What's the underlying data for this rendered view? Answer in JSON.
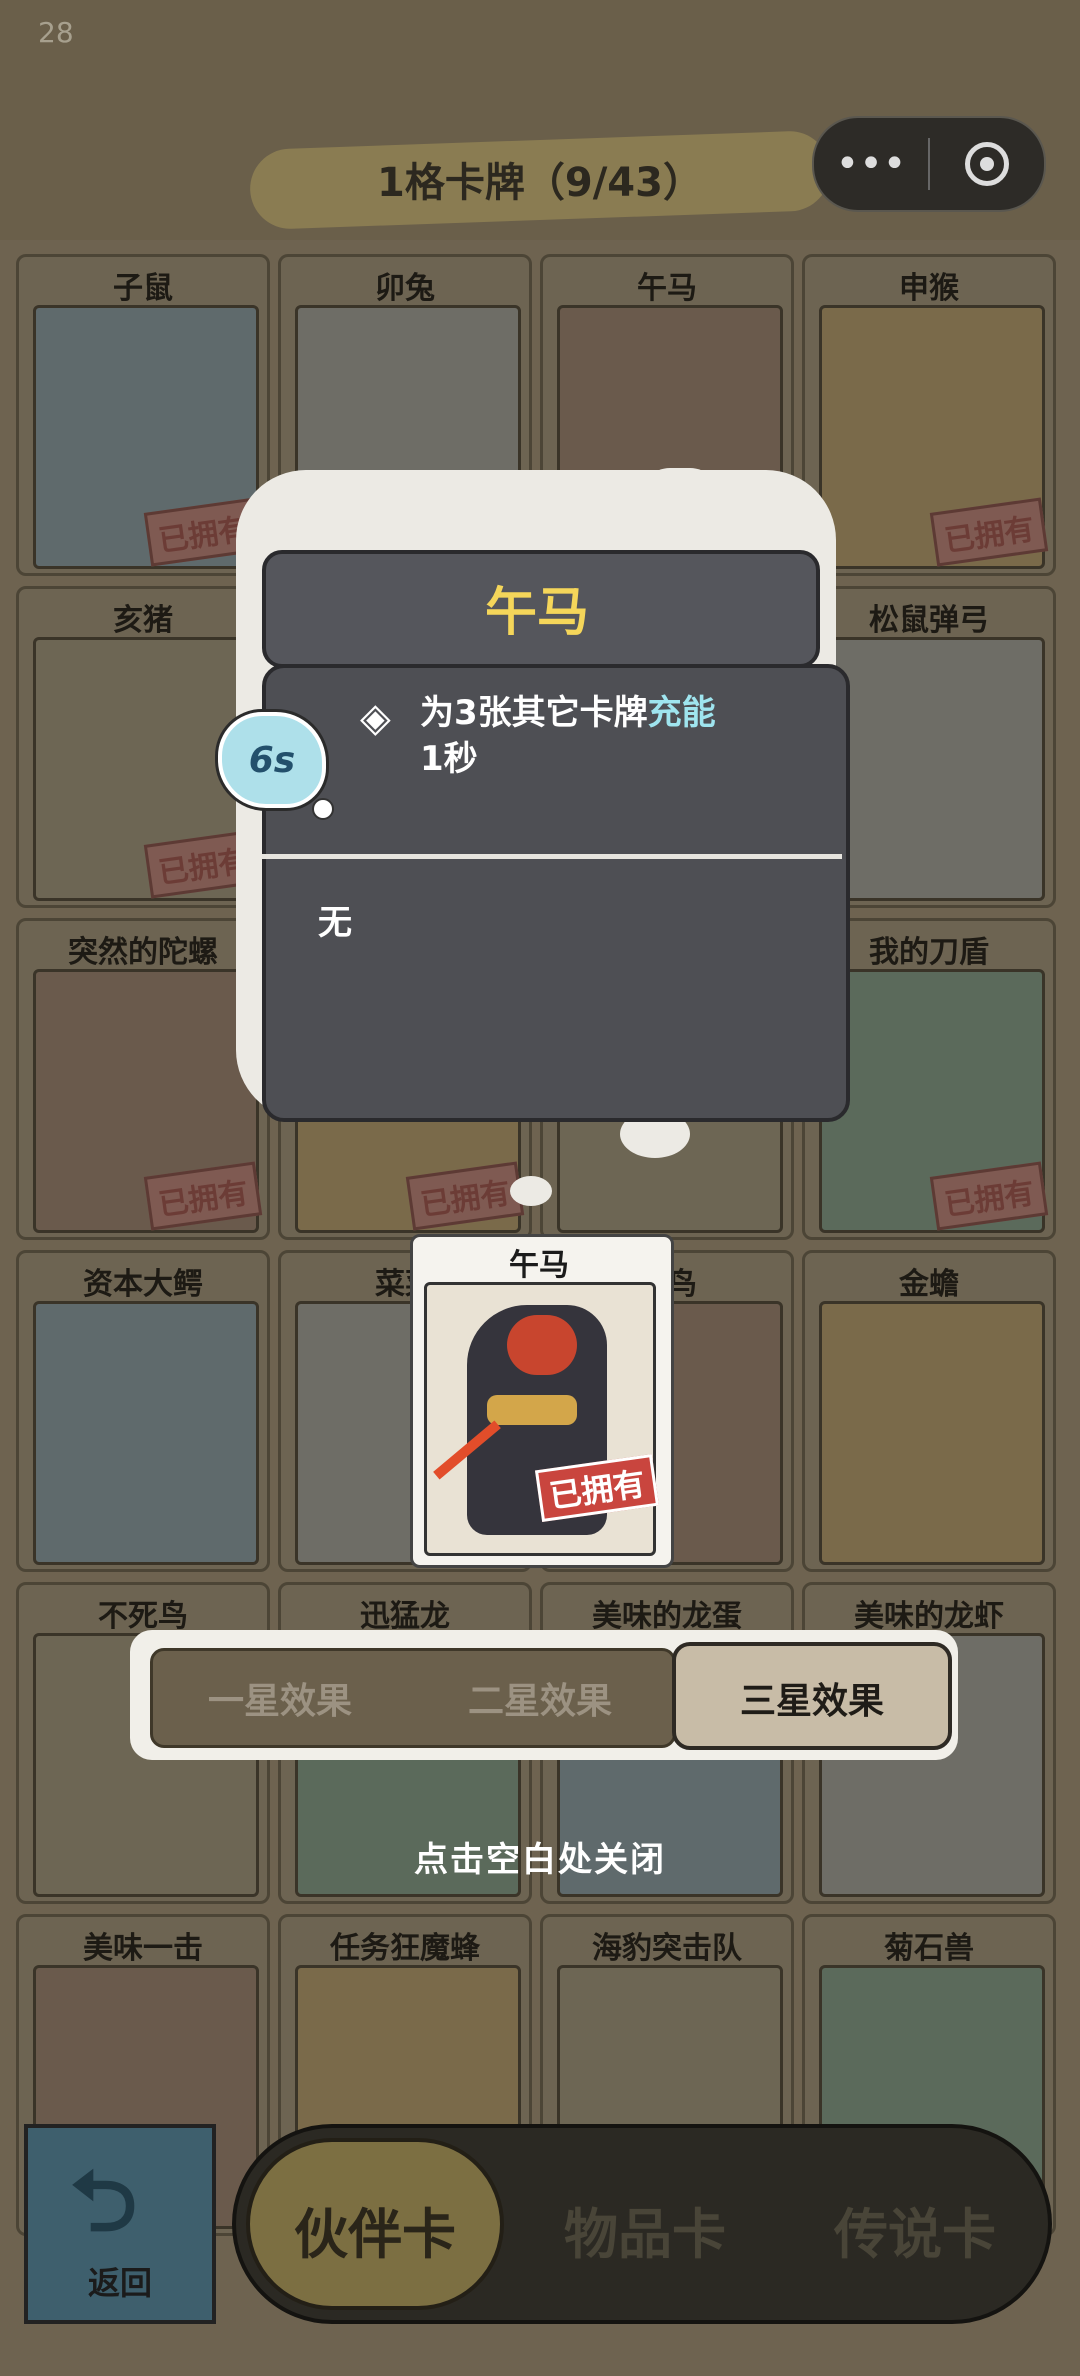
{
  "status": {
    "left_number": "28"
  },
  "header": {
    "title": "1格卡牌（9/43）",
    "more_icon": "more-dots-icon",
    "close_icon": "target-icon"
  },
  "cards": [
    {
      "name": "子鼠",
      "owned": true
    },
    {
      "name": "卯兔",
      "owned": false
    },
    {
      "name": "午马",
      "owned": false
    },
    {
      "name": "申猴",
      "owned": true
    },
    {
      "name": "亥猪",
      "owned": true
    },
    {
      "name": "",
      "owned": false
    },
    {
      "name": "",
      "owned": false
    },
    {
      "name": "松鼠弹弓",
      "owned": false
    },
    {
      "name": "突然的陀螺",
      "owned": true
    },
    {
      "name": "",
      "owned": true
    },
    {
      "name": "",
      "owned": false
    },
    {
      "name": "我的刀盾",
      "owned": true
    },
    {
      "name": "资本大鳄",
      "owned": false
    },
    {
      "name": "菜菜",
      "owned": false
    },
    {
      "name": "小鸟",
      "owned": false
    },
    {
      "name": "金蟾",
      "owned": false
    },
    {
      "name": "不死鸟",
      "owned": false
    },
    {
      "name": "迅猛龙",
      "owned": false
    },
    {
      "name": "美味的龙蛋",
      "owned": false
    },
    {
      "name": "美味的龙虾",
      "owned": false
    },
    {
      "name": "美味一击",
      "owned": false
    },
    {
      "name": "任务狂魔蜂",
      "owned": false
    },
    {
      "name": "海豹突击队",
      "owned": false
    },
    {
      "name": "菊石兽",
      "owned": false
    }
  ],
  "owned_label": "已拥有",
  "popup": {
    "title": "午马",
    "cooldown": "6s",
    "effect_prefix": "为3张其它卡牌",
    "effect_highlight": "充能",
    "effect_suffix": "1秒",
    "secondary_effect": "无"
  },
  "preview": {
    "name": "午马",
    "owned_label": "已拥有"
  },
  "star_tabs": {
    "one": "一星效果",
    "two": "二星效果",
    "three": "三星效果",
    "selected": "三星效果"
  },
  "close_hint": "点击空白处关闭",
  "bottom": {
    "back_label": "返回",
    "tabs": [
      "伙伴卡",
      "物品卡",
      "传说卡"
    ],
    "selected_tab": "伙伴卡"
  }
}
